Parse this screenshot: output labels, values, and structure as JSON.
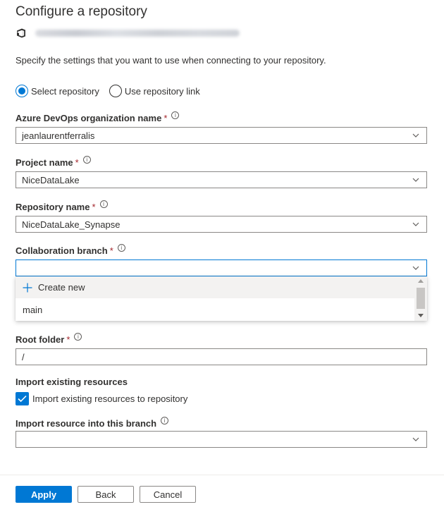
{
  "panel": {
    "title": "Configure a repository",
    "description": "Specify the settings that you want to use when connecting to your repository."
  },
  "source": {
    "options": [
      {
        "label": "Select repository",
        "selected": true
      },
      {
        "label": "Use repository link",
        "selected": false
      }
    ]
  },
  "fields": {
    "organization": {
      "label": "Azure DevOps organization name",
      "required": "*",
      "value": "jeanlaurentferralis"
    },
    "project": {
      "label": "Project name",
      "required": "*",
      "value": "NiceDataLake"
    },
    "repository": {
      "label": "Repository name",
      "required": "*",
      "value": "NiceDataLake_Synapse"
    },
    "branch": {
      "label": "Collaboration branch",
      "required": "*",
      "value": ""
    },
    "root_folder": {
      "label": "Root folder",
      "required": "*",
      "value": "/"
    },
    "import_branch": {
      "label": "Import resource into this branch",
      "value": ""
    }
  },
  "branch_menu": {
    "create_new": "Create new",
    "items": [
      "main"
    ]
  },
  "import": {
    "section_label": "Import existing resources",
    "checkbox_label": "Import existing resources to repository",
    "checked": true
  },
  "info_glyph": "i",
  "icons": {
    "repo": "azure-devops-repo-icon",
    "info": "info-icon",
    "chevron": "chevron-down-icon",
    "plus": "plus-icon",
    "check": "checkmark-icon"
  },
  "colors": {
    "accent": "#0078d4",
    "required": "#a4262c",
    "text": "#323130",
    "border": "#8a8886"
  },
  "buttons": {
    "apply": "Apply",
    "back": "Back",
    "cancel": "Cancel"
  }
}
